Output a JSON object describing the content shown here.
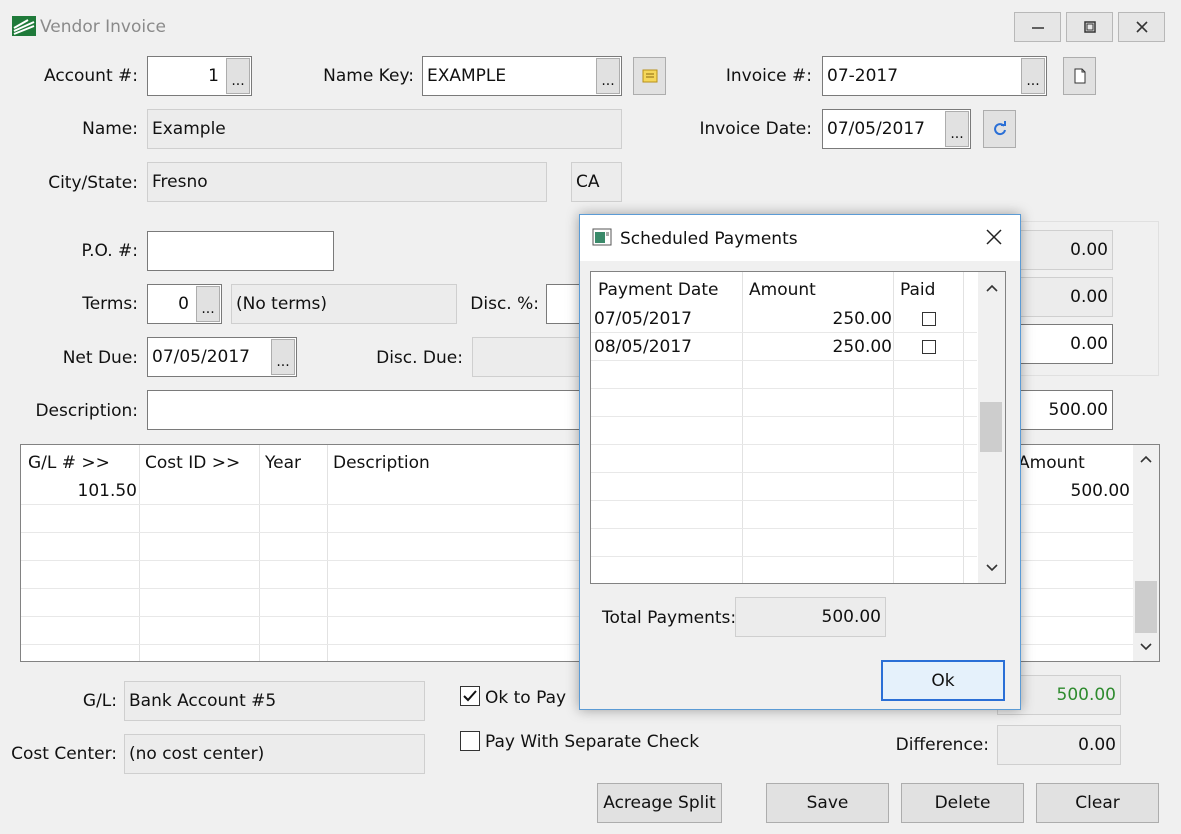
{
  "window": {
    "title": "Vendor Invoice",
    "minimize_icon": "minimize-icon",
    "maximize_icon": "maximize-icon",
    "close_icon": "close-icon"
  },
  "form": {
    "account_label": "Account #:",
    "account_value": "1",
    "name_key_label": "Name Key:",
    "name_key_value": "EXAMPLE",
    "invoice_label": "Invoice #:",
    "invoice_value": "07-2017",
    "name_label": "Name:",
    "name_value": "Example",
    "invoice_date_label": "Invoice Date:",
    "invoice_date_value": "07/05/2017",
    "city_state_label": "City/State:",
    "city_value": "Fresno",
    "state_value": "CA",
    "po_label": "P.O. #:",
    "po_value": "",
    "terms_label": "Terms:",
    "terms_value": "0",
    "terms_desc": "(No terms)",
    "disc_pct_label": "Disc. %:",
    "disc_pct_value": "",
    "net_due_label": "Net Due:",
    "net_due_value": "07/05/2017",
    "disc_due_label": "Disc. Due:",
    "disc_due_value": "",
    "description_label": "Description:",
    "description_value": "",
    "right_amounts": [
      "0.00",
      "0.00",
      "0.00",
      "500.00"
    ],
    "ellipsis": "..."
  },
  "gl_grid": {
    "columns": [
      "G/L # >>",
      "Cost ID >>",
      "Year",
      "Description",
      "Amount"
    ],
    "rows": [
      {
        "gl": "101.50",
        "cost_id": "",
        "year": "",
        "description": "",
        "amount": "500.00"
      }
    ]
  },
  "bottom": {
    "gl_label": "G/L:",
    "gl_value": "Bank Account #5",
    "cost_center_label": "Cost Center:",
    "cost_center_value": "(no cost center)",
    "ok_to_pay_label": "Ok to Pay",
    "ok_to_pay_checked": true,
    "separate_check_label": "Pay With Separate Check",
    "separate_check_checked": false,
    "total_value": "500.00",
    "total_color": "#2e8b2e",
    "difference_label": "Difference:",
    "difference_value": "0.00"
  },
  "buttons": {
    "acreage_split": "Acreage Split",
    "save": "Save",
    "delete": "Delete",
    "clear": "Clear"
  },
  "dialog": {
    "title": "Scheduled Payments",
    "columns": [
      "Payment Date",
      "Amount",
      "Paid"
    ],
    "rows": [
      {
        "date": "07/05/2017",
        "amount": "250.00",
        "paid": false
      },
      {
        "date": "08/05/2017",
        "amount": "250.00",
        "paid": false
      }
    ],
    "total_label": "Total Payments:",
    "total_value": "500.00",
    "ok_label": "Ok"
  },
  "colors": {
    "accent": "#5b9bd5",
    "window_bg": "#f0f0f0"
  }
}
